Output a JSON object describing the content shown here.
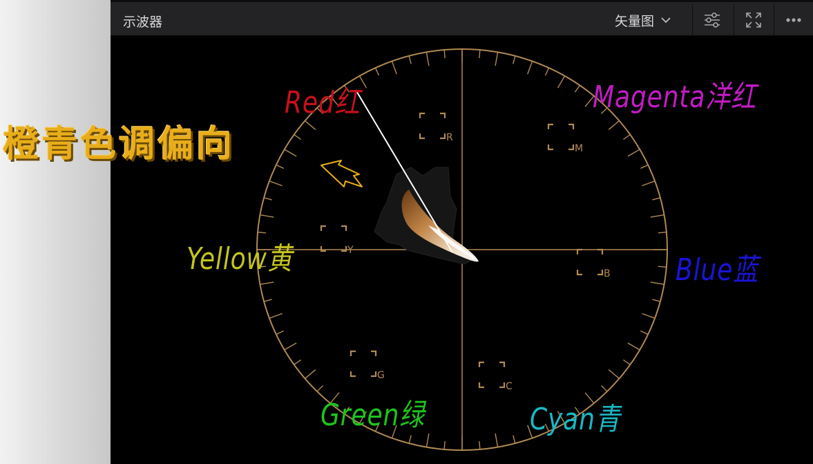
{
  "caption": "橙青色调偏向",
  "window": {
    "title": "示波器",
    "mode": "矢量图",
    "buttons": [
      "settings-sliders-icon",
      "fullscreen-icon",
      "more-options-icon"
    ]
  },
  "scope": {
    "targets": [
      "R",
      "M",
      "B",
      "C",
      "G",
      "Y"
    ],
    "colors": {
      "graticule": "#b08a55",
      "red": "#c8101a",
      "magenta": "#c21cc4",
      "blue": "#1a14d8",
      "cyan": "#19b8c4",
      "green": "#1ec41e",
      "yellow": "#c4c41e"
    }
  },
  "labels": {
    "red": "Red红",
    "magenta": "Magenta洋红",
    "yellow": "Yellow黄",
    "blue": "Blue蓝",
    "green": "Green绿",
    "cyan": "Cyan青"
  }
}
